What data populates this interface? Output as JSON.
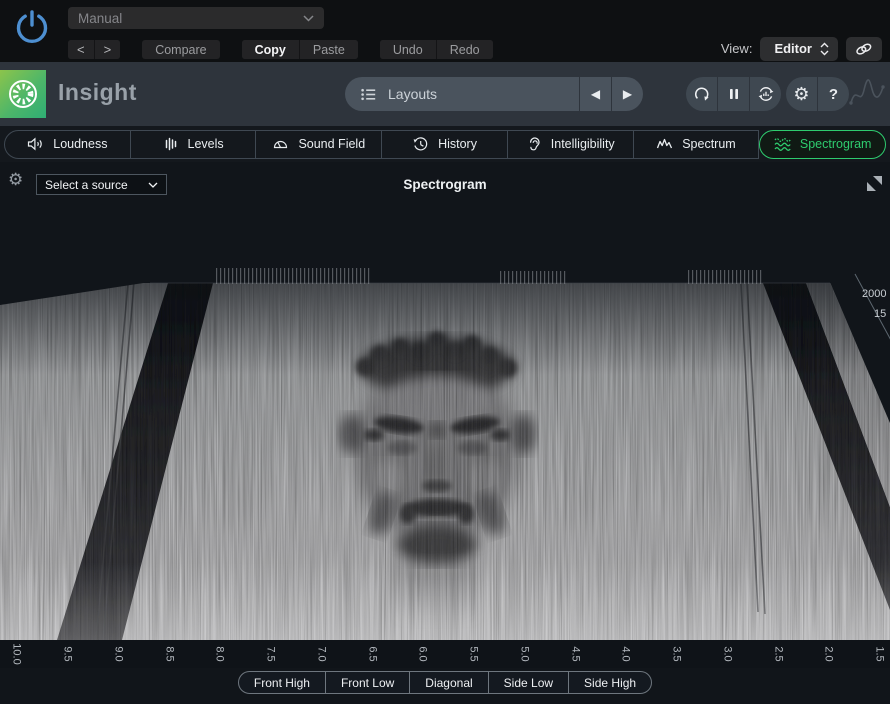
{
  "topbar": {
    "preset": {
      "value": "Manual"
    },
    "nav_back": "<",
    "nav_forward": ">",
    "compare": "Compare",
    "copy": "Copy",
    "paste": "Paste",
    "undo": "Undo",
    "redo": "Redo",
    "view_label": "View:",
    "view_value": "Editor"
  },
  "header": {
    "app_title": "Insight",
    "layouts_label": "Layouts",
    "prev_icon": "◀",
    "next_icon": "▶",
    "gear_icon": "⚙",
    "help_label": "?"
  },
  "tabs": [
    {
      "label": "Loudness",
      "icon": "speaker-icon",
      "active": false
    },
    {
      "label": "Levels",
      "icon": "level-bars-icon",
      "active": false
    },
    {
      "label": "Sound Field",
      "icon": "sound-field-icon",
      "active": false
    },
    {
      "label": "History",
      "icon": "history-clock-icon",
      "active": false
    },
    {
      "label": "Intelligibility",
      "icon": "ear-icon",
      "active": false
    },
    {
      "label": "Spectrum",
      "icon": "spectrum-icon",
      "active": false
    },
    {
      "label": "Spectrogram",
      "icon": "spectrogram-waves-icon",
      "active": true
    }
  ],
  "panel": {
    "gear_icon": "⚙",
    "source_select": {
      "value": "Select a source"
    },
    "title": "Spectrogram",
    "freq_axis_labels": [
      "2000",
      "15"
    ],
    "time_axis": [
      "10.0",
      "9.5",
      "9.0",
      "8.5",
      "8.0",
      "7.5",
      "7.0",
      "6.5",
      "6.0",
      "5.5",
      "5.0",
      "4.5",
      "4.0",
      "3.5",
      "3.0",
      "2.5",
      "2.0",
      "1.5"
    ],
    "view_buttons": [
      "Front High",
      "Front Low",
      "Diagonal",
      "Side Low",
      "Side High"
    ]
  },
  "colors": {
    "accent_green": "#2ecb6e",
    "power_blue": "#4d8fd1",
    "header_slate": "#2e343c",
    "logo_gradient_start": "#8cc44b",
    "logo_gradient_end": "#2fae74"
  }
}
